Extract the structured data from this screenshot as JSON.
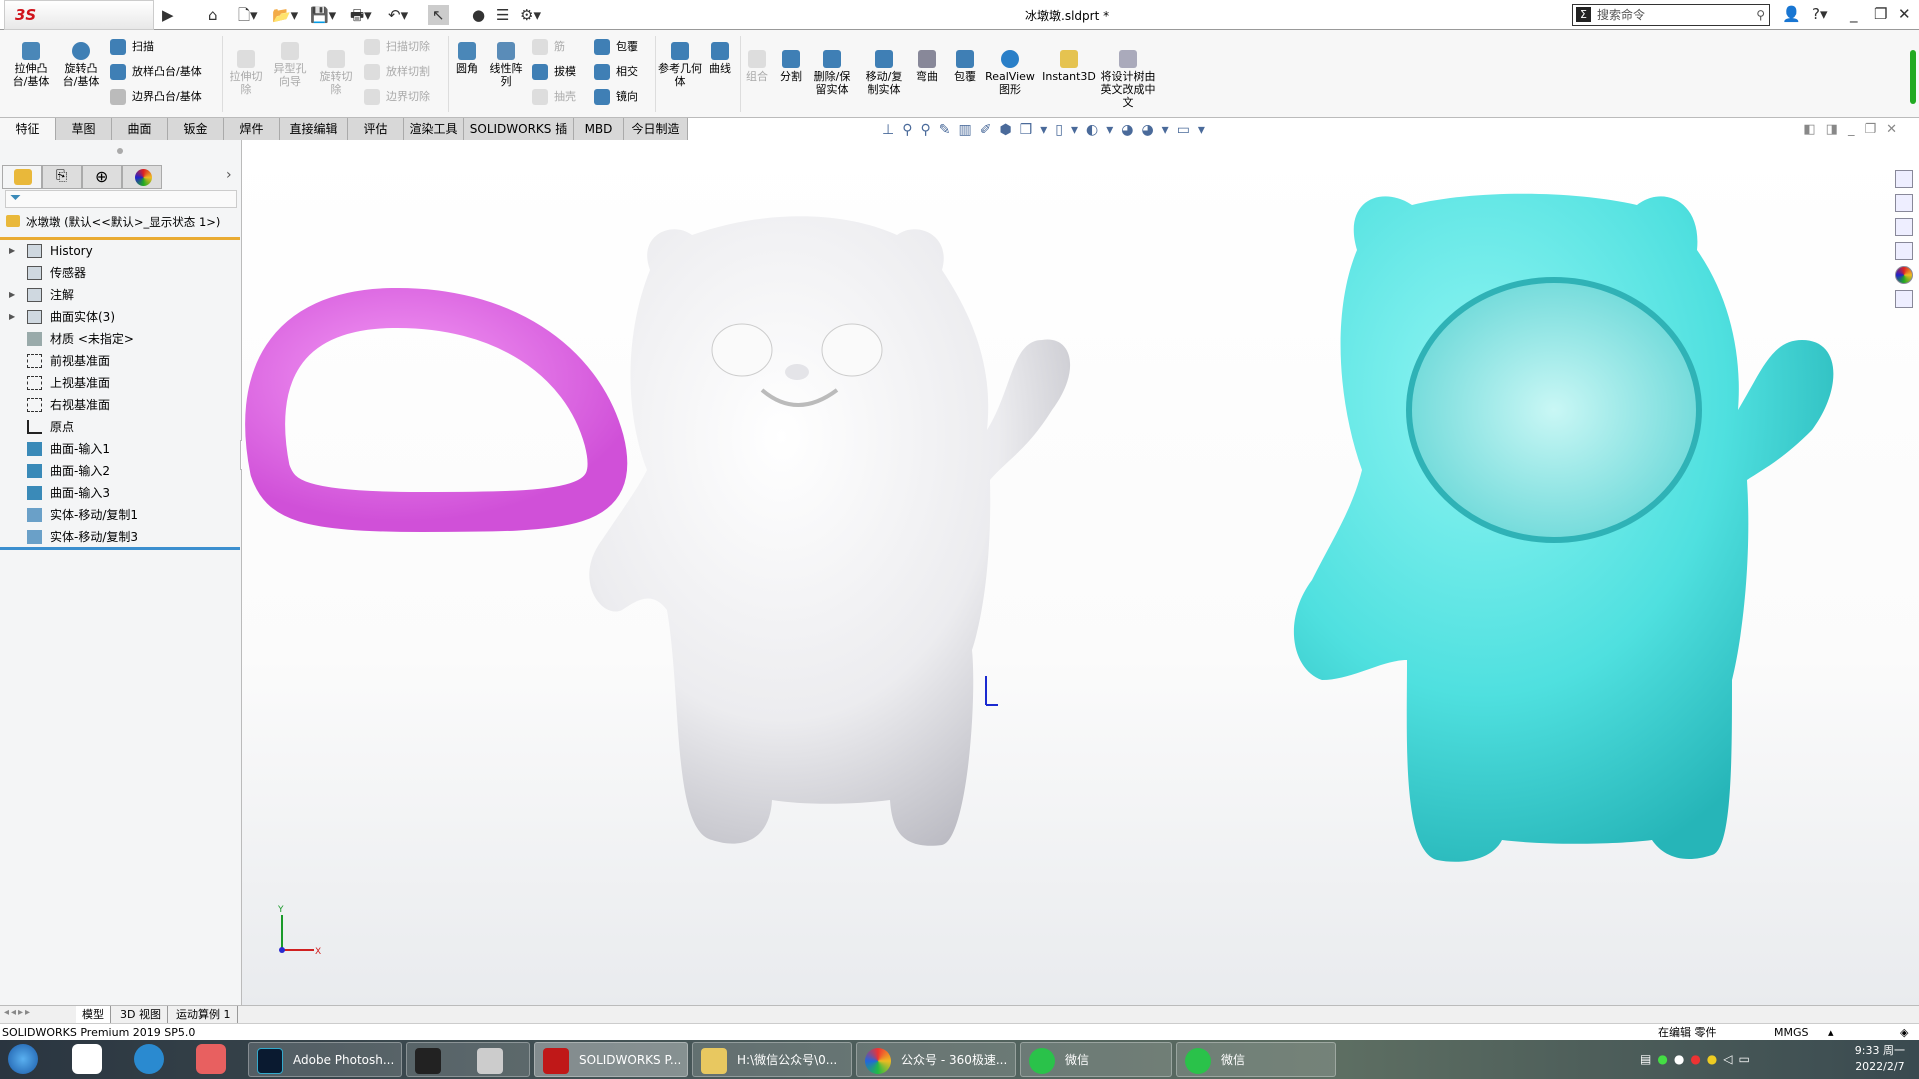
{
  "app": {
    "logo": "SOLIDWORKS",
    "doc_title": "冰墩墩.sldprt *",
    "search_placeholder": "搜索命令"
  },
  "ribbon": {
    "large": [
      "拉伸凸台/基体",
      "旋转凸台/基体",
      "拉伸切除",
      "异型孔向导",
      "旋转切除",
      "圆角",
      "线性阵列",
      "参考几何体",
      "曲线",
      "组合",
      "分割",
      "删除/保留实体",
      "移动/复制实体",
      "弯曲",
      "包覆",
      "RealView 图形",
      "Instant3D",
      "将设计树由英文改成中文"
    ],
    "small": [
      "扫描",
      "放样凸台/基体",
      "边界凸台/基体",
      "扫描切除",
      "放样切割",
      "边界切除",
      "筋",
      "拔模",
      "抽壳",
      "包覆",
      "相交",
      "镜向"
    ]
  },
  "tabs": [
    "特征",
    "草图",
    "曲面",
    "钣金",
    "焊件",
    "直接编辑",
    "评估",
    "渲染工具",
    "SOLIDWORKS 插件",
    "MBD",
    "今日制造"
  ],
  "tree": {
    "root": "冰墩墩  (默认<<默认>_显示状态 1>)",
    "items": [
      {
        "label": "History",
        "expandable": true,
        "icon": "history-folder-icon"
      },
      {
        "label": "传感器",
        "expandable": false,
        "icon": "sensor-folder-icon"
      },
      {
        "label": "注解",
        "expandable": true,
        "icon": "annotation-folder-icon"
      },
      {
        "label": "曲面实体(3)",
        "expandable": true,
        "icon": "surface-bodies-folder-icon"
      },
      {
        "label": "材质 <未指定>",
        "expandable": false,
        "icon": "material-icon"
      },
      {
        "label": "前视基准面",
        "expandable": false,
        "icon": "plane-icon"
      },
      {
        "label": "上视基准面",
        "expandable": false,
        "icon": "plane-icon"
      },
      {
        "label": "右视基准面",
        "expandable": false,
        "icon": "plane-icon"
      },
      {
        "label": "原点",
        "expandable": false,
        "icon": "origin-icon"
      },
      {
        "label": "曲面-输入1",
        "expandable": false,
        "icon": "surface-icon"
      },
      {
        "label": "曲面-输入2",
        "expandable": false,
        "icon": "surface-icon"
      },
      {
        "label": "曲面-输入3",
        "expandable": false,
        "icon": "surface-icon"
      },
      {
        "label": "实体-移动/复制1",
        "expandable": false,
        "icon": "move-copy-icon"
      },
      {
        "label": "实体-移动/复制3",
        "expandable": false,
        "icon": "move-copy-icon"
      }
    ]
  },
  "bottom_tabs": [
    "模型",
    "3D 视图",
    "运动算例 1"
  ],
  "status": {
    "left": "SOLIDWORKS Premium 2019 SP5.0",
    "editing": "在编辑 零件",
    "units": "MMGS"
  },
  "taskbar": {
    "items": [
      "Adobe Photosh...",
      "SOLIDWORKS P...",
      "H:\\微信公众号\\0...",
      "公众号 - 360极速...",
      "微信",
      "微信"
    ],
    "time": "9:33 周一",
    "date": "2022/2/7"
  },
  "colors": {
    "ring": "#e36ee8",
    "cyan_body": "#4fe0df",
    "white_body": "#f2f2f4",
    "accent_orange": "#e9ab32",
    "accent_blue": "#3b8fcf"
  }
}
